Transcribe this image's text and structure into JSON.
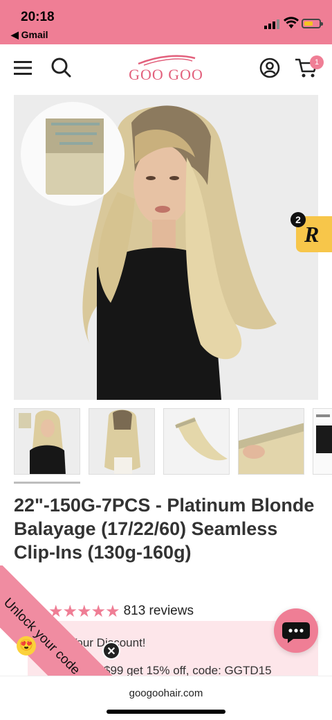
{
  "status_bar": {
    "time": "20:18",
    "back_label": "◀ Gmail",
    "battery_color": "#f5c422"
  },
  "header": {
    "logo_text": "GOO GOO",
    "cart_count": "1",
    "menu_icon": "hamburger-icon",
    "search_icon": "search-icon",
    "account_icon": "account-icon",
    "cart_icon": "cart-icon"
  },
  "colors": {
    "brand_pink": "#ef7e95",
    "logo_pink": "#e2607c",
    "review_yellow": "#f7c64a"
  },
  "review_widget": {
    "count": "2",
    "letter": "R"
  },
  "product": {
    "title": "22\"-150G-7PCS - Platinum Blonde Balayage (17/22/60) Seamless Clip-Ins (130g-160g)",
    "rating_stars": "★★★★★",
    "rating_value": 5,
    "reviews_label": "813 reviews"
  },
  "thumbnails": [
    {
      "name": "model-front"
    },
    {
      "name": "model-back"
    },
    {
      "name": "single-weft"
    },
    {
      "name": "wefts-in-hand"
    },
    {
      "name": "color-chart"
    }
  ],
  "discount": {
    "title": "Get Your Discount!",
    "title_visible": "et Your Discount!",
    "offer_visible": "$99 get 15% off, code: GGTD15"
  },
  "unlock_ribbon": {
    "label": "Unlock your code",
    "emoji": "😍"
  },
  "browser": {
    "url": "googoohair.com"
  }
}
